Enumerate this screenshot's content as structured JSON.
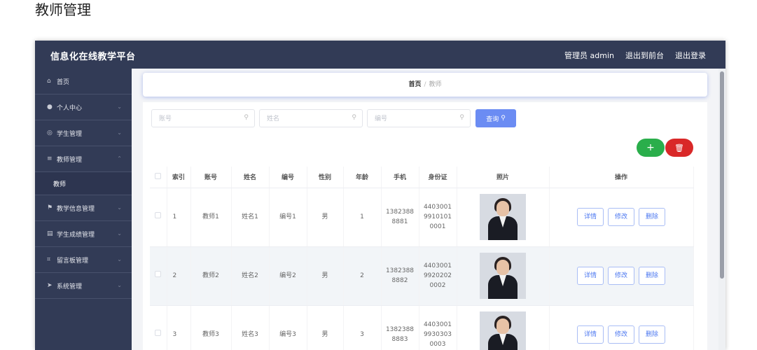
{
  "page": {
    "heading": "教师管理"
  },
  "header": {
    "brand": "信息化在线教学平台",
    "admin_label": "管理员 admin",
    "front_link": "退出到前台",
    "logout_link": "退出登录"
  },
  "sidebar": {
    "items": [
      {
        "label": "首页",
        "icon": "home-icon"
      },
      {
        "label": "个人中心",
        "icon": "user-icon"
      },
      {
        "label": "学生管理",
        "icon": "globe-icon"
      },
      {
        "label": "教师管理",
        "icon": "menu-icon"
      },
      {
        "label": "教学信息管理",
        "icon": "flag-icon"
      },
      {
        "label": "学生成绩管理",
        "icon": "document-icon"
      },
      {
        "label": "留言板管理",
        "icon": "crop-icon"
      },
      {
        "label": "系统管理",
        "icon": "send-icon"
      }
    ],
    "sub_item": "教师"
  },
  "breadcrumb": {
    "home": "首页",
    "separator": "/",
    "current": "教师"
  },
  "search": {
    "account_placeholder": "账号",
    "name_placeholder": "姓名",
    "number_placeholder": "编号",
    "query_label": "查询"
  },
  "actions": {
    "add_symbol": "+",
    "delete_symbol": "🗑"
  },
  "table": {
    "headers": [
      "索引",
      "账号",
      "姓名",
      "编号",
      "性别",
      "年龄",
      "手机",
      "身份证",
      "照片",
      "操作"
    ],
    "rows": [
      {
        "index": "1",
        "account": "教师1",
        "name": "姓名1",
        "number": "编号1",
        "gender": "男",
        "age": "1",
        "phone_a": "1382388",
        "phone_b": "8881",
        "id_a": "4403001",
        "id_b": "9910101",
        "id_c": "0001"
      },
      {
        "index": "2",
        "account": "教师2",
        "name": "姓名2",
        "number": "编号2",
        "gender": "男",
        "age": "2",
        "phone_a": "1382388",
        "phone_b": "8882",
        "id_a": "4403001",
        "id_b": "9920202",
        "id_c": "0002"
      },
      {
        "index": "3",
        "account": "教师3",
        "name": "姓名3",
        "number": "编号3",
        "gender": "男",
        "age": "3",
        "phone_a": "1382388",
        "phone_b": "8883",
        "id_a": "4403001",
        "id_b": "9930303",
        "id_c": "0003"
      }
    ],
    "op_detail": "详情",
    "op_edit": "修改",
    "op_delete": "删除"
  },
  "colors": {
    "sidebar_bg": "#323b56",
    "primary": "#6b8cf3",
    "success": "#2aae4b",
    "danger": "#d92828"
  }
}
